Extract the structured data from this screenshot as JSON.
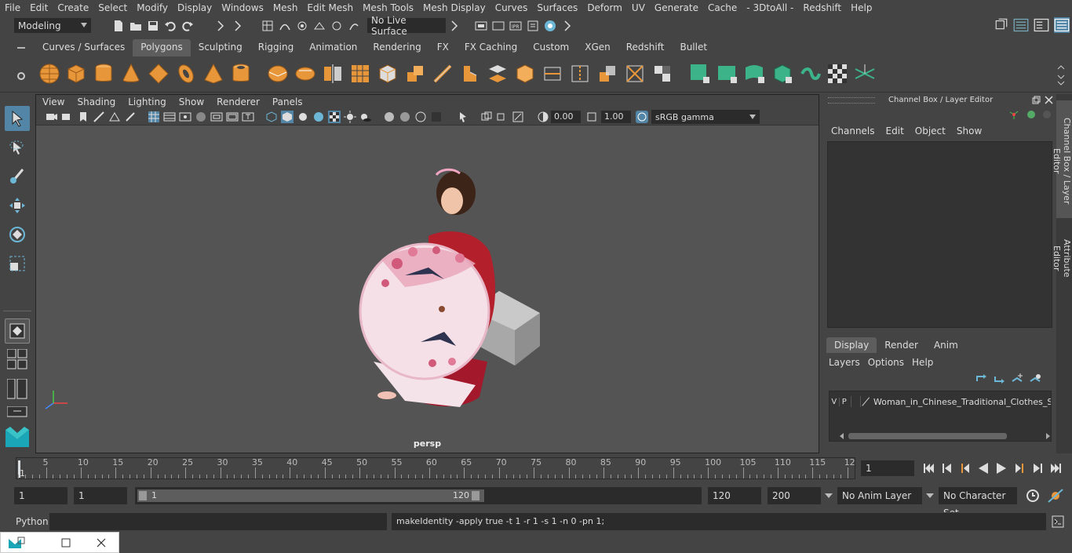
{
  "menubar": [
    "File",
    "Edit",
    "Create",
    "Select",
    "Modify",
    "Display",
    "Windows",
    "Mesh",
    "Edit Mesh",
    "Mesh Tools",
    "Mesh Display",
    "Curves",
    "Surfaces",
    "Deform",
    "UV",
    "Generate",
    "Cache",
    "- 3DtoAll -",
    "Redshift",
    "Help"
  ],
  "statusline": {
    "mode": "Modeling",
    "live_surface": "No Live Surface"
  },
  "shelf_tabs": [
    {
      "label": "Curves / Surfaces",
      "active": false
    },
    {
      "label": "Polygons",
      "active": true
    },
    {
      "label": "Sculpting",
      "active": false
    },
    {
      "label": "Rigging",
      "active": false
    },
    {
      "label": "Animation",
      "active": false
    },
    {
      "label": "Rendering",
      "active": false
    },
    {
      "label": "FX",
      "active": false
    },
    {
      "label": "FX Caching",
      "active": false
    },
    {
      "label": "Custom",
      "active": false
    },
    {
      "label": "XGen",
      "active": false
    },
    {
      "label": "Redshift",
      "active": false
    },
    {
      "label": "Bullet",
      "active": false
    }
  ],
  "viewport": {
    "menu": [
      "View",
      "Shading",
      "Lighting",
      "Show",
      "Renderer",
      "Panels"
    ],
    "exposure": "0.00",
    "gamma": "1.00",
    "colorspace": "sRGB gamma",
    "camera_label": "persp"
  },
  "channel_box": {
    "title": "Channel Box / Layer Editor",
    "menu": [
      "Channels",
      "Edit",
      "Object",
      "Show"
    ],
    "layer_tabs": [
      "Display",
      "Render",
      "Anim"
    ],
    "active_layer_tab": "Display",
    "layer_menu": [
      "Layers",
      "Options",
      "Help"
    ],
    "layer": {
      "v": "V",
      "p": "P",
      "name": "Woman_in_Chinese_Traditional_Clothes_Sit"
    }
  },
  "side_tabs": [
    "Channel Box / Layer Editor",
    "Attribute Editor"
  ],
  "timeline": {
    "ticks": [
      "5",
      "10",
      "15",
      "20",
      "25",
      "30",
      "35",
      "40",
      "45",
      "50",
      "55",
      "60",
      "65",
      "70",
      "75",
      "80",
      "85",
      "90",
      "95",
      "100",
      "105",
      "110",
      "115",
      "12"
    ],
    "start_marker": "1",
    "current_frame": "1"
  },
  "range": {
    "start": "1",
    "playback_start": "1",
    "slider_start": "1",
    "slider_end": "120",
    "playback_end": "120",
    "end": "200",
    "anim_layer": "No Anim Layer",
    "character_set": "No Character Set"
  },
  "cmdline": {
    "language": "Python",
    "result": "makeIdentity -apply true -t 1 -r 1 -s 1 -n 0 -pn 1;"
  },
  "colors": {
    "shelf_orange": "#e8963a",
    "shelf_green": "#3db38a",
    "accent_blue": "#5285a6",
    "bg": "#444444",
    "viewport": "#545454"
  }
}
